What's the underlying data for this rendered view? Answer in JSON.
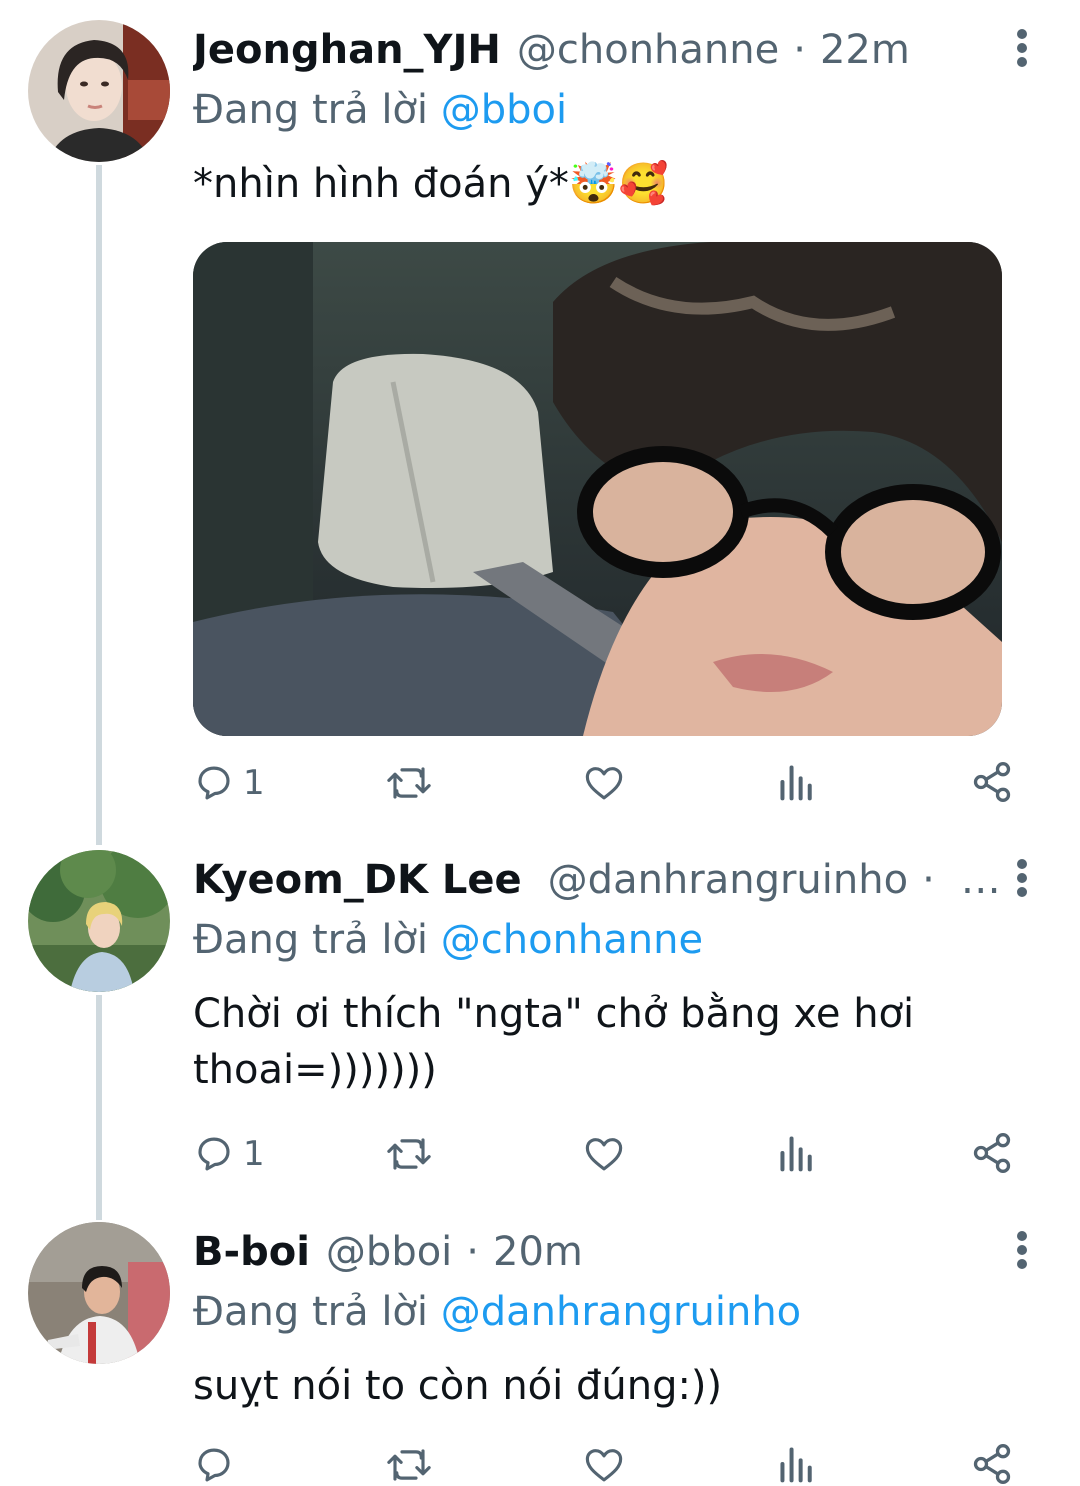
{
  "tweets": [
    {
      "name": "Jeonghan_YJH",
      "handle": "@chonhanne",
      "separator": "·",
      "time": "22m",
      "replying_prefix": "Đang trả lời",
      "replying_to": "@bboi",
      "text": "*nhìn hình đoán ý*🤯🥰",
      "reply_count": "1",
      "icons": [
        "reply-icon",
        "retweet-icon",
        "like-icon",
        "views-icon",
        "share-icon",
        "more-icon"
      ]
    },
    {
      "name": "Kyeom_DK Lee",
      "handle": "@danhrangruinho",
      "separator": "·",
      "time_truncated": "…",
      "replying_prefix": "Đang trả lời",
      "replying_to": "@chonhanne",
      "text_line1": "Chời ơi thích \"ngta\" chở bằng xe hơi",
      "text_line2": "thoai=)))))))",
      "reply_count": "1"
    },
    {
      "name": "B-boi",
      "handle": "@bboi",
      "separator": "·",
      "time": "20m",
      "replying_prefix": "Đang trả lời",
      "replying_to": "@danhrangruinho",
      "text": "suỵt nói to còn nói đúng:))"
    }
  ],
  "colors": {
    "accent": "#1d9bf0",
    "secondary_text": "#536471",
    "thread_line": "#cfd9de",
    "primary_text": "#0f1419"
  }
}
